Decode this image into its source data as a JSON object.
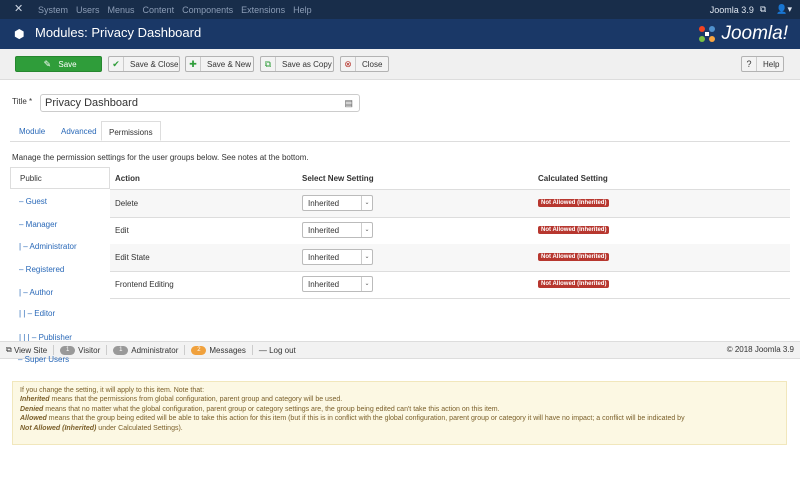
{
  "topnav": {
    "menu": [
      "System",
      "Users",
      "Menus",
      "Content",
      "Components",
      "Extensions",
      "Help"
    ],
    "version": "Joomla 3.9",
    "ext_icon": "external-link-icon",
    "user_icon": "user-icon"
  },
  "header": {
    "title": "Modules: Privacy Dashboard",
    "brand": "Joomla!"
  },
  "toolbar": {
    "save": "Save",
    "save_close": "Save & Close",
    "save_new": "Save & New",
    "save_copy": "Save as Copy",
    "close": "Close",
    "help": "Help"
  },
  "form": {
    "title_label": "Title *",
    "title_value": "Privacy Dashboard"
  },
  "tabs": [
    "Module",
    "Advanced",
    "Permissions"
  ],
  "manage_text": "Manage the permission settings for the user groups below. See notes at the bottom.",
  "groups": [
    "Public",
    "– Guest",
    "– Manager",
    "|   – Administrator",
    "– Registered",
    "|   – Author",
    "|   |   – Editor",
    "|   |   |   – Publisher",
    "– Super Users"
  ],
  "table": {
    "headers": [
      "Action",
      "Select New Setting",
      "Calculated Setting"
    ],
    "rows": [
      {
        "action": "Delete",
        "setting": "Inherited",
        "calculated": "Not Allowed (Inherited)"
      },
      {
        "action": "Edit",
        "setting": "Inherited",
        "calculated": "Not Allowed (Inherited)"
      },
      {
        "action": "Edit State",
        "setting": "Inherited",
        "calculated": "Not Allowed (Inherited)"
      },
      {
        "action": "Frontend Editing",
        "setting": "Inherited",
        "calculated": "Not Allowed (Inherited)"
      }
    ]
  },
  "status": {
    "view_site": "View Site",
    "visitor_count": "1",
    "visitor": "Visitor",
    "admin_count": "1",
    "admin": "Administrator",
    "msg_count": "2",
    "messages": "Messages",
    "logout": "Log out",
    "copyright": "© 2018 Joomla 3.9"
  },
  "notes": {
    "intro": "If you change the setting, it will apply to this item. Note that:",
    "inherited_term": "Inherited",
    "inherited_text": " means that the permissions from global configuration, parent group and category will be used.",
    "denied_term": "Denied",
    "denied_text": " means that no matter what the global configuration, parent group or category settings are, the group being edited can't take this action on this item.",
    "allowed_term": "Allowed",
    "allowed_text": " means that the group being edited will be able to take this action for this item (but if this is in conflict with the global configuration, parent group or category it will have no impact; a conflict will be indicated by",
    "na_term": "Not Allowed (Inherited)",
    "na_text": " under Calculated Settings)."
  },
  "colors": {
    "topnav": "#182d4a",
    "header": "#1a3867",
    "save_green": "#2f9d3a",
    "badge_red": "#b7372f",
    "link_blue": "#2a69b8"
  }
}
